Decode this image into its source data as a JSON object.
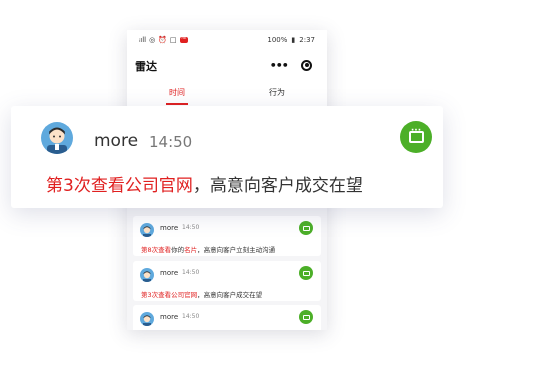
{
  "status_bar": {
    "signal": "ᵢıll",
    "wifi": "◎",
    "alarm": "⏰",
    "battery_saver": "□",
    "badge": "ᴴᴰ",
    "battery": "100%",
    "battery_icon": "▮",
    "time": "2:37"
  },
  "navbar": {
    "title": "雷达",
    "more_glyph": "•••"
  },
  "tabs": [
    {
      "label": "时间",
      "active": true
    },
    {
      "label": "行为",
      "active": false
    }
  ],
  "feed": [
    {
      "name": "more",
      "time": "14:50",
      "highlight": "第8次查看",
      "mid": "你的",
      "highlight2": "名片",
      "tail": "，高意向客户立刻主动沟通"
    },
    {
      "name": "more",
      "time": "14:50",
      "highlight": "第3次查看公司官网",
      "mid": "",
      "highlight2": "",
      "tail": "，高意向客户成交在望"
    },
    {
      "name": "more",
      "time": "14:50",
      "highlight": "",
      "mid": "",
      "highlight2": "",
      "tail": ""
    }
  ],
  "featured": {
    "name": "more",
    "time": "14:50",
    "highlight": "第3次查看公司官网",
    "tail": "，高意向客户成交在望"
  },
  "colors": {
    "accent_red": "#e02020",
    "chat_green": "#4caf28",
    "avatar_blue": "#5fa9dd"
  }
}
